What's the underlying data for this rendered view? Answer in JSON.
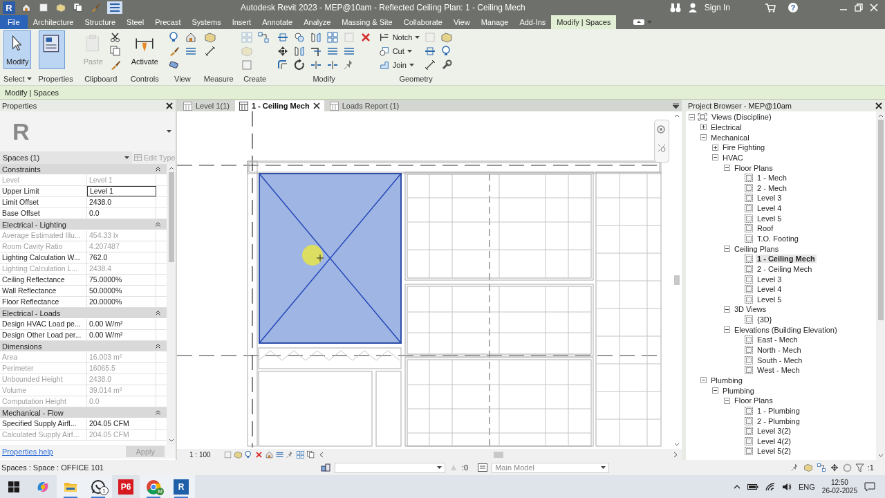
{
  "title_bar": {
    "logo": "R",
    "title": "Autodesk Revit 2023 - MEP@10am - Reflected Ceiling Plan: 1 - Ceiling Mech",
    "sign_in": "Sign In",
    "help": "?"
  },
  "ribbon_tabs": [
    {
      "label": "File",
      "kind": "file",
      "selected": false
    },
    {
      "label": "Architecture",
      "kind": "tab",
      "selected": false
    },
    {
      "label": "Structure",
      "kind": "tab",
      "selected": false
    },
    {
      "label": "Steel",
      "kind": "tab",
      "selected": false
    },
    {
      "label": "Precast",
      "kind": "tab",
      "selected": false
    },
    {
      "label": "Systems",
      "kind": "tab",
      "selected": false
    },
    {
      "label": "Insert",
      "kind": "tab",
      "selected": false
    },
    {
      "label": "Annotate",
      "kind": "tab",
      "selected": false
    },
    {
      "label": "Analyze",
      "kind": "tab",
      "selected": false
    },
    {
      "label": "Massing & Site",
      "kind": "tab",
      "selected": false
    },
    {
      "label": "Collaborate",
      "kind": "tab",
      "selected": false
    },
    {
      "label": "View",
      "kind": "tab",
      "selected": false
    },
    {
      "label": "Manage",
      "kind": "tab",
      "selected": false
    },
    {
      "label": "Add-Ins",
      "kind": "tab",
      "selected": false
    },
    {
      "label": "Modify | Spaces",
      "kind": "tab",
      "selected": true
    }
  ],
  "ribbon_panels": [
    {
      "label": "Select",
      "dropdown": true,
      "tools": [
        {
          "kind": "large",
          "label": "Modify",
          "active": true,
          "disabled": false
        }
      ]
    },
    {
      "label": "Properties",
      "dropdown": false,
      "tools": [
        {
          "kind": "large",
          "active": true,
          "disabled": false
        }
      ]
    },
    {
      "label": "Clipboard",
      "dropdown": false,
      "tools": [
        {
          "kind": "large",
          "label": "Paste",
          "active": false,
          "disabled": true
        },
        {
          "kind": "small",
          "active": false,
          "disabled": false
        },
        {
          "kind": "small",
          "active": false,
          "disabled": false
        },
        {
          "kind": "small",
          "active": false,
          "disabled": false
        }
      ]
    },
    {
      "label": "Controls",
      "dropdown": false,
      "tools": [
        {
          "kind": "large",
          "label": "Activate",
          "active": false,
          "disabled": false
        }
      ]
    },
    {
      "label": "View",
      "dropdown": false,
      "tools": [
        {
          "kind": "small",
          "active": false,
          "disabled": false
        },
        {
          "kind": "small",
          "active": false,
          "disabled": false
        },
        {
          "kind": "small",
          "active": false,
          "disabled": false
        },
        {
          "kind": "small",
          "active": false,
          "disabled": false
        },
        {
          "kind": "small",
          "active": false,
          "disabled": false
        }
      ]
    },
    {
      "label": "Measure",
      "dropdown": false,
      "tools": [
        {
          "kind": "small",
          "active": false,
          "disabled": false
        },
        {
          "kind": "small",
          "active": false,
          "disabled": false
        }
      ]
    },
    {
      "label": "Create",
      "dropdown": false,
      "tools": [
        {
          "kind": "small",
          "active": false,
          "disabled": true
        },
        {
          "kind": "small",
          "active": false,
          "disabled": true
        },
        {
          "kind": "small",
          "active": false,
          "disabled": false
        },
        {
          "kind": "small",
          "active": false,
          "disabled": false
        }
      ]
    },
    {
      "label": "Modify",
      "dropdown": false,
      "tools": [
        {
          "kind": "small",
          "active": false,
          "disabled": false
        },
        {
          "kind": "small",
          "active": false,
          "disabled": false
        },
        {
          "kind": "small",
          "active": false,
          "disabled": false
        },
        {
          "kind": "small",
          "active": false,
          "disabled": false
        },
        {
          "kind": "small",
          "active": false,
          "disabled": false
        },
        {
          "kind": "small",
          "active": false,
          "disabled": false
        },
        {
          "kind": "small",
          "active": false,
          "disabled": false
        },
        {
          "kind": "small",
          "active": false,
          "disabled": false
        },
        {
          "kind": "small",
          "active": false,
          "disabled": false
        },
        {
          "kind": "small",
          "active": false,
          "disabled": false
        },
        {
          "kind": "small",
          "active": false,
          "disabled": false
        },
        {
          "kind": "small",
          "active": false,
          "disabled": false
        },
        {
          "kind": "small",
          "active": false,
          "disabled": true
        },
        {
          "kind": "small",
          "active": false,
          "disabled": false
        },
        {
          "kind": "small",
          "active": false,
          "disabled": false
        },
        {
          "kind": "small",
          "active": false,
          "disabled": false
        }
      ]
    },
    {
      "label": "Geometry",
      "dropdown": false,
      "tools": [
        {
          "kind": "labeled",
          "label": "Notch",
          "active": false,
          "disabled": false
        },
        {
          "kind": "labeled",
          "label": "Cut",
          "active": false,
          "disabled": false
        },
        {
          "kind": "labeled",
          "label": "Join",
          "active": false,
          "disabled": false
        },
        {
          "kind": "small",
          "active": false,
          "disabled": true
        },
        {
          "kind": "small",
          "active": false,
          "disabled": false
        },
        {
          "kind": "small",
          "active": false,
          "disabled": false
        },
        {
          "kind": "small",
          "active": false,
          "disabled": false
        },
        {
          "kind": "small",
          "active": false,
          "disabled": false
        },
        {
          "kind": "small",
          "active": false,
          "disabled": false
        }
      ]
    }
  ],
  "context_bar": "Modify | Spaces",
  "properties": {
    "title": "Properties",
    "type_logo": "R",
    "type_selector": "Spaces (1)",
    "edit_type": "Edit Type",
    "sections": [
      {
        "title": "Constraints",
        "rows": [
          {
            "label": "Level",
            "value": "Level 1",
            "disabled": true,
            "editing": false
          },
          {
            "label": "Upper Limit",
            "value": "Level 1",
            "disabled": false,
            "editing": true
          },
          {
            "label": "Limit Offset",
            "value": "2438.0",
            "disabled": false,
            "editing": false
          },
          {
            "label": "Base Offset",
            "value": "0.0",
            "disabled": false,
            "editing": false
          }
        ]
      },
      {
        "title": "Electrical - Lighting",
        "rows": [
          {
            "label": "Average Estimated Illu...",
            "value": "454.33 lx",
            "disabled": true,
            "editing": false
          },
          {
            "label": "Room Cavity Ratio",
            "value": "4.207487",
            "disabled": true,
            "editing": false
          },
          {
            "label": "Lighting Calculation W...",
            "value": "762.0",
            "disabled": false,
            "editing": false
          },
          {
            "label": "Lighting Calculation L...",
            "value": "2438.4",
            "disabled": true,
            "editing": false
          },
          {
            "label": "Ceiling Reflectance",
            "value": "75.0000%",
            "disabled": false,
            "editing": false
          },
          {
            "label": "Wall Reflectance",
            "value": "50.0000%",
            "disabled": false,
            "editing": false
          },
          {
            "label": "Floor Reflectance",
            "value": "20.0000%",
            "disabled": false,
            "editing": false
          }
        ]
      },
      {
        "title": "Electrical - Loads",
        "rows": [
          {
            "label": "Design HVAC Load pe...",
            "value": "0.00 W/m²",
            "disabled": false,
            "editing": false
          },
          {
            "label": "Design Other Load per...",
            "value": "0.00 W/m²",
            "disabled": false,
            "editing": false
          }
        ]
      },
      {
        "title": "Dimensions",
        "rows": [
          {
            "label": "Area",
            "value": "16.003 m²",
            "disabled": true,
            "editing": false
          },
          {
            "label": "Perimeter",
            "value": "16065.5",
            "disabled": true,
            "editing": false
          },
          {
            "label": "Unbounded Height",
            "value": "2438.0",
            "disabled": true,
            "editing": false
          },
          {
            "label": "Volume",
            "value": "39.014 m³",
            "disabled": true,
            "editing": false
          },
          {
            "label": "Computation Height",
            "value": "0.0",
            "disabled": true,
            "editing": false
          }
        ]
      },
      {
        "title": "Mechanical - Flow",
        "rows": [
          {
            "label": "Specified Supply Airfl...",
            "value": "204.05 CFM",
            "disabled": false,
            "editing": false
          },
          {
            "label": "Calculated Supply Airf...",
            "value": "204.05 CFM",
            "disabled": true,
            "editing": false
          }
        ]
      }
    ],
    "help_link": "Properties help",
    "apply": "Apply"
  },
  "view_tabs": [
    {
      "label": "Level 1(1)",
      "selected": false
    },
    {
      "label": "1 - Ceiling Mech",
      "selected": true
    },
    {
      "label": "Loads Report (1)",
      "selected": false
    }
  ],
  "view": {
    "scale": "1 : 100"
  },
  "project_browser": {
    "title": "Project Browser - MEP@10am",
    "tree": [
      {
        "label": "Views (Discipline)",
        "kind": "root",
        "expanded": true,
        "selected": false,
        "children": [
          {
            "label": "Electrical",
            "kind": "group",
            "expanded": false,
            "selected": false
          },
          {
            "label": "Mechanical",
            "kind": "group",
            "expanded": true,
            "selected": false,
            "children": [
              {
                "label": "Fire Fighting",
                "kind": "group",
                "expanded": false,
                "selected": false
              },
              {
                "label": "HVAC",
                "kind": "group",
                "expanded": true,
                "selected": false,
                "children": [
                  {
                    "label": "Floor Plans",
                    "kind": "group",
                    "expanded": true,
                    "selected": false,
                    "children": [
                      {
                        "label": "1 - Mech",
                        "kind": "view",
                        "selected": false
                      },
                      {
                        "label": "2 - Mech",
                        "kind": "view",
                        "selected": false
                      },
                      {
                        "label": "Level 3",
                        "kind": "view",
                        "selected": false
                      },
                      {
                        "label": "Level 4",
                        "kind": "view",
                        "selected": false
                      },
                      {
                        "label": "Level 5",
                        "kind": "view",
                        "selected": false
                      },
                      {
                        "label": "Roof",
                        "kind": "view",
                        "selected": false
                      },
                      {
                        "label": "T.O. Footing",
                        "kind": "view",
                        "selected": false
                      }
                    ]
                  },
                  {
                    "label": "Ceiling Plans",
                    "kind": "group",
                    "expanded": true,
                    "selected": false,
                    "children": [
                      {
                        "label": "1 - Ceiling Mech",
                        "kind": "view",
                        "selected": true
                      },
                      {
                        "label": "2 - Ceiling Mech",
                        "kind": "view",
                        "selected": false
                      },
                      {
                        "label": "Level 3",
                        "kind": "view",
                        "selected": false
                      },
                      {
                        "label": "Level 4",
                        "kind": "view",
                        "selected": false
                      },
                      {
                        "label": "Level 5",
                        "kind": "view",
                        "selected": false
                      }
                    ]
                  },
                  {
                    "label": "3D Views",
                    "kind": "group",
                    "expanded": true,
                    "selected": false,
                    "children": [
                      {
                        "label": "{3D}",
                        "kind": "view",
                        "selected": false
                      }
                    ]
                  },
                  {
                    "label": "Elevations (Building Elevation)",
                    "kind": "group",
                    "expanded": true,
                    "selected": false,
                    "children": [
                      {
                        "label": "East - Mech",
                        "kind": "view",
                        "selected": false
                      },
                      {
                        "label": "North - Mech",
                        "kind": "view",
                        "selected": false
                      },
                      {
                        "label": "South - Mech",
                        "kind": "view",
                        "selected": false
                      },
                      {
                        "label": "West - Mech",
                        "kind": "view",
                        "selected": false
                      }
                    ]
                  }
                ]
              }
            ]
          },
          {
            "label": "Plumbing",
            "kind": "group",
            "expanded": true,
            "selected": false,
            "children": [
              {
                "label": "Plumbing",
                "kind": "group",
                "expanded": true,
                "selected": false,
                "children": [
                  {
                    "label": "Floor Plans",
                    "kind": "group",
                    "expanded": true,
                    "selected": false,
                    "children": [
                      {
                        "label": "1 - Plumbing",
                        "kind": "view",
                        "selected": false
                      },
                      {
                        "label": "2 - Plumbing",
                        "kind": "view",
                        "selected": false
                      },
                      {
                        "label": "Level 3(2)",
                        "kind": "view",
                        "selected": false
                      },
                      {
                        "label": "Level 4(2)",
                        "kind": "view",
                        "selected": false
                      },
                      {
                        "label": "Level 5(2)",
                        "kind": "view",
                        "selected": false
                      }
                    ]
                  }
                ]
              }
            ]
          }
        ]
      }
    ]
  },
  "status_bar": {
    "text": "Spaces : Space : OFFICE 101",
    "count": ":0",
    "model": "Main Model",
    "filter_count": ":1"
  },
  "taskbar": {
    "apps": [
      {
        "kind": "copilot",
        "open": false
      },
      {
        "kind": "folder",
        "open": true
      },
      {
        "kind": "whatsapp",
        "badge": "1",
        "open": true
      },
      {
        "kind": "tile",
        "label": "P6",
        "color": "#d71920",
        "open": false
      },
      {
        "kind": "chrome",
        "badge": "M",
        "open": true
      },
      {
        "kind": "tile",
        "label": "R",
        "color": "#1f5fa8",
        "open": true
      }
    ],
    "language": "ENG",
    "time": "12:50",
    "date": "26-02-2025"
  }
}
